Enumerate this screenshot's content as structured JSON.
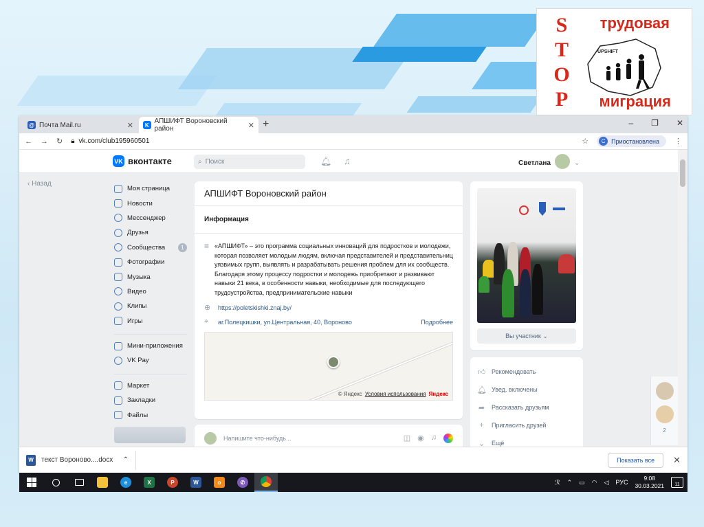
{
  "logo": {
    "letters": [
      "S",
      "T",
      "O",
      "P"
    ],
    "top_word": "трудовая",
    "bottom_word": "миграция",
    "brand": "UPSHIFT"
  },
  "browser": {
    "tabs": [
      {
        "label": "Почта Mail.ru",
        "active": false
      },
      {
        "label": "АПШИФТ Вороновский район",
        "active": true
      }
    ],
    "new_tab": "+",
    "window_controls": [
      "–",
      "❐",
      "✕"
    ],
    "url": "vk.com/club195960501",
    "profile_initial": "С",
    "profile_status": "Приостановлена"
  },
  "vk": {
    "logo_text": "вконтакте",
    "search_placeholder": "Поиск",
    "user_name": "Светлана",
    "back_label": "Назад",
    "nav": [
      {
        "label": "Моя страница",
        "icon": "user-icon"
      },
      {
        "label": "Новости",
        "icon": "news-icon"
      },
      {
        "label": "Мессенджер",
        "icon": "chat-icon"
      },
      {
        "label": "Друзья",
        "icon": "friends-icon"
      },
      {
        "label": "Сообщества",
        "icon": "groups-icon",
        "badge": "1"
      },
      {
        "label": "Фотографии",
        "icon": "photo-icon"
      },
      {
        "label": "Музыка",
        "icon": "music-icon"
      },
      {
        "label": "Видео",
        "icon": "video-icon"
      },
      {
        "label": "Клипы",
        "icon": "clips-icon"
      },
      {
        "label": "Игры",
        "icon": "games-icon"
      }
    ],
    "nav2": [
      {
        "label": "Мини-приложения",
        "icon": "apps-icon"
      },
      {
        "label": "VK Pay",
        "icon": "pay-icon"
      }
    ],
    "nav3": [
      {
        "label": "Маркет",
        "icon": "market-icon"
      },
      {
        "label": "Закладки",
        "icon": "bookmark-icon"
      },
      {
        "label": "Файлы",
        "icon": "files-icon"
      }
    ],
    "group": {
      "title": "АПШИФТ Вороновский район",
      "info_tab": "Информация",
      "description": "«АПШИФТ» – это программа социальных инноваций для подростков и молодежи, которая позволяет молодым людям, включая представителей и представительниц уязвимых групп, выявлять и разрабатывать решения проблем для их сообществ. Благодаря этому процессу подростки и молодежь приобретают и развивают навыки 21 века, в особенности навыки, необходимые для последующего трудоустройства, предпринимательские навыки",
      "website": "https://poletskishki.znaj.by/",
      "address": "аг.Полецкишки, ул.Центральная, 40, Вороново",
      "more_label": "Подробнее",
      "map_copyright": "© Яндекс",
      "map_terms": "Условия использования",
      "map_brand": "Яндекс"
    },
    "post_placeholder": "Напишите что-нибудь...",
    "member_button": "Вы участник",
    "actions": [
      {
        "label": "Рекомендовать",
        "icon": "thumb-up-icon"
      },
      {
        "label": "Увед. включены",
        "icon": "bell-check-icon"
      },
      {
        "label": "Рассказать друзьям",
        "icon": "share-icon"
      },
      {
        "label": "Пригласить друзей",
        "icon": "invite-icon"
      },
      {
        "label": "Ещё",
        "icon": "chevron-down-icon"
      }
    ],
    "chat_count": "2"
  },
  "downloads": {
    "file": "текст Вороново....docx",
    "show_all": "Показать все"
  },
  "taskbar": {
    "apps": [
      "search",
      "task-view",
      "explorer",
      "edge",
      "excel",
      "powerpoint",
      "word",
      "odnoklassniki",
      "viber",
      "chrome"
    ],
    "lang": "РУС",
    "time": "9:08",
    "date": "30.03.2021",
    "notif_count": "11"
  }
}
